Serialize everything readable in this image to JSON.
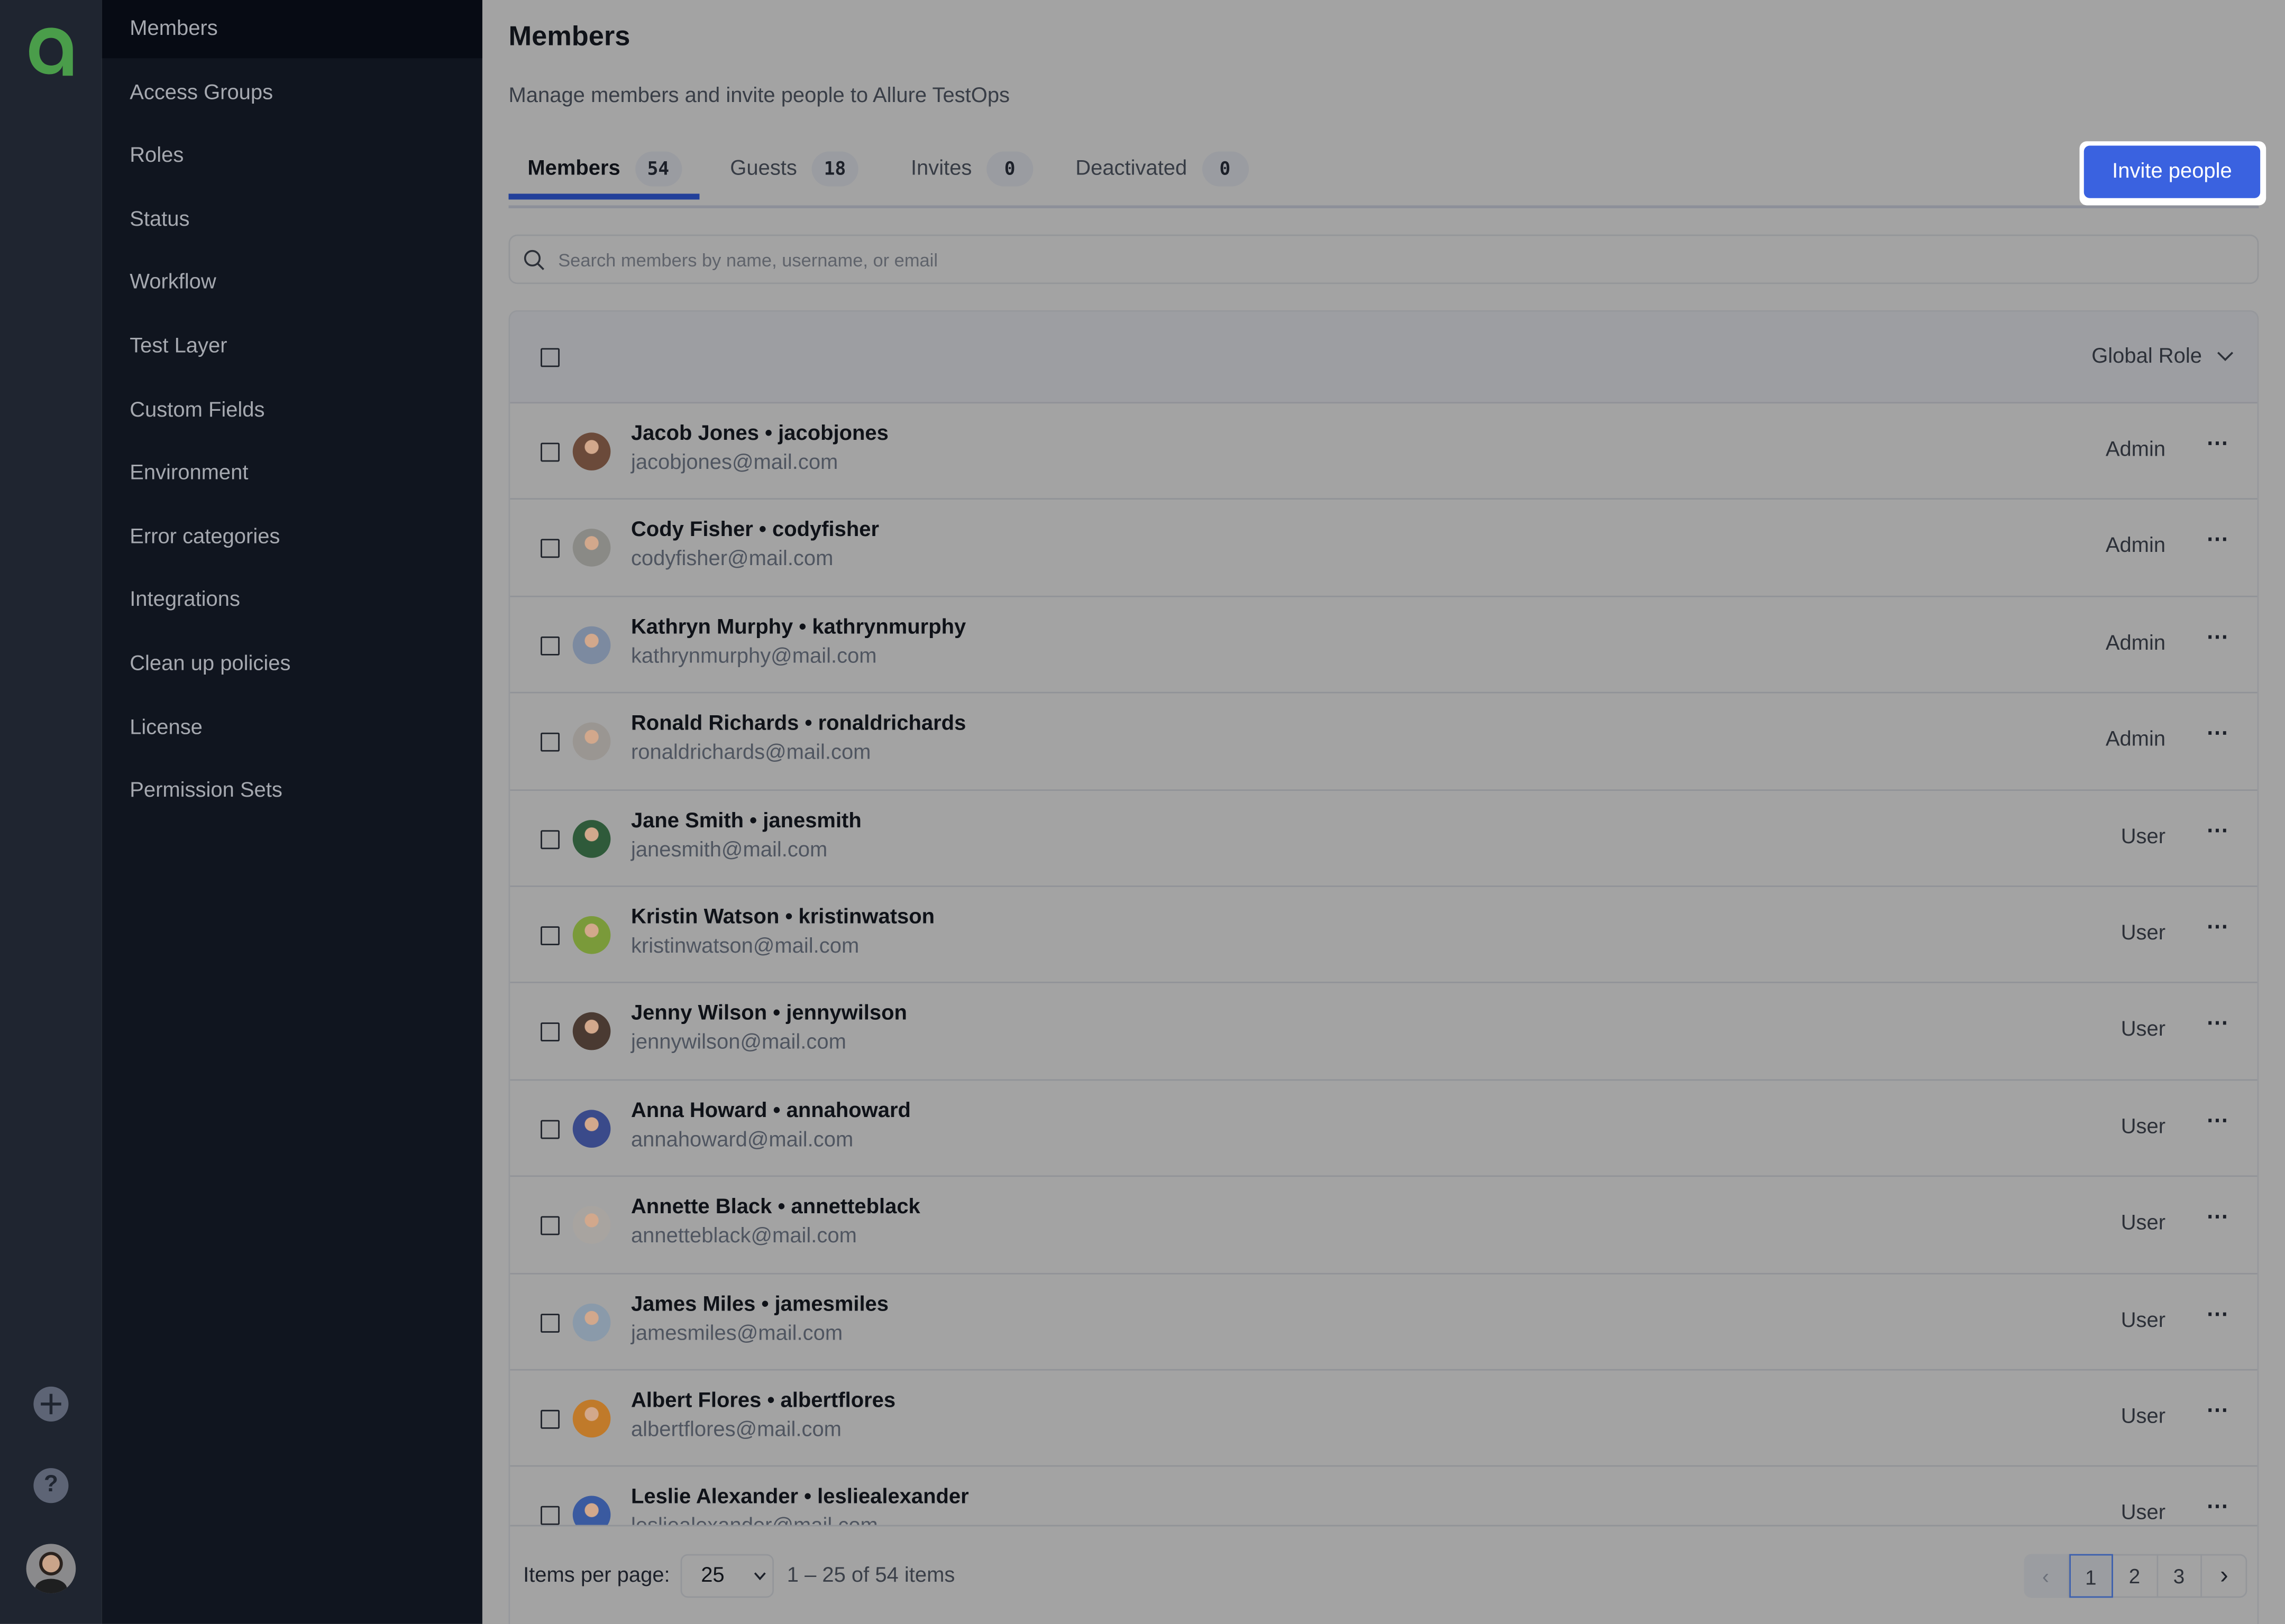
{
  "app": {
    "logo": "Allure TestOps logo",
    "brand_color": "#4a9d4a"
  },
  "sidebar": {
    "items": [
      {
        "label": "Members",
        "active": true
      },
      {
        "label": "Access Groups"
      },
      {
        "label": "Roles"
      },
      {
        "label": "Status"
      },
      {
        "label": "Workflow"
      },
      {
        "label": "Test Layer"
      },
      {
        "label": "Custom Fields"
      },
      {
        "label": "Environment"
      },
      {
        "label": "Error categories"
      },
      {
        "label": "Integrations"
      },
      {
        "label": "Clean up policies"
      },
      {
        "label": "License"
      },
      {
        "label": "Permission Sets"
      }
    ],
    "rail_icons": [
      "plus-circle-icon",
      "help-circle-icon",
      "user-avatar"
    ]
  },
  "header": {
    "title": "Members",
    "subtitle": "Manage members and invite people to Allure TestOps",
    "invite_label": "Invite people",
    "accent": "#3a62e0"
  },
  "tabs": [
    {
      "label": "Members",
      "count": "54",
      "active": true
    },
    {
      "label": "Guests",
      "count": "18"
    },
    {
      "label": "Invites",
      "count": "0"
    },
    {
      "label": "Deactivated",
      "count": "0"
    }
  ],
  "search": {
    "placeholder": "Search members by name, username, or email",
    "value": ""
  },
  "table": {
    "role_column": "Global Role",
    "rows": [
      {
        "name": "Jacob Jones • jacobjones",
        "email": "jacobjones@mail.com",
        "role": "Admin",
        "avatar": "#6b4a3a"
      },
      {
        "name": "Cody Fisher • codyfisher",
        "email": "codyfisher@mail.com",
        "role": "Admin",
        "avatar": "#8a8a86"
      },
      {
        "name": "Kathryn Murphy • kathrynmurphy",
        "email": "kathrynmurphy@mail.com",
        "role": "Admin",
        "avatar": "#7c8aa0"
      },
      {
        "name": "Ronald Richards • ronaldrichards",
        "email": "ronaldrichards@mail.com",
        "role": "Admin",
        "avatar": "#9a9692"
      },
      {
        "name": "Jane Smith • janesmith",
        "email": "janesmith@mail.com",
        "role": "User",
        "avatar": "#2f5a3a"
      },
      {
        "name": "Kristin Watson • kristinwatson",
        "email": "kristinwatson@mail.com",
        "role": "User",
        "avatar": "#7a9a3a"
      },
      {
        "name": "Jenny Wilson • jennywilson",
        "email": "jennywilson@mail.com",
        "role": "User",
        "avatar": "#4a3a32"
      },
      {
        "name": "Anna Howard • annahoward",
        "email": "annahoward@mail.com",
        "role": "User",
        "avatar": "#3a4a8a"
      },
      {
        "name": "Annette Black • annetteblack",
        "email": "annetteblack@mail.com",
        "role": "User",
        "avatar": "#a8a4a0"
      },
      {
        "name": "James Miles • jamesmiles",
        "email": "jamesmiles@mail.com",
        "role": "User",
        "avatar": "#8a9aaa"
      },
      {
        "name": "Albert Flores • albertflores",
        "email": "albertflores@mail.com",
        "role": "User",
        "avatar": "#c07a2a"
      },
      {
        "name": "Leslie Alexander • lesliealexander",
        "email": "lesliealexander@mail.com",
        "role": "User",
        "avatar": "#3a5aa0"
      }
    ]
  },
  "footer": {
    "items_per_page_label": "Items per page:",
    "items_per_page": "25",
    "range": "1 – 25 of 54 items",
    "pages": [
      "1",
      "2",
      "3"
    ],
    "current_page": "1"
  }
}
